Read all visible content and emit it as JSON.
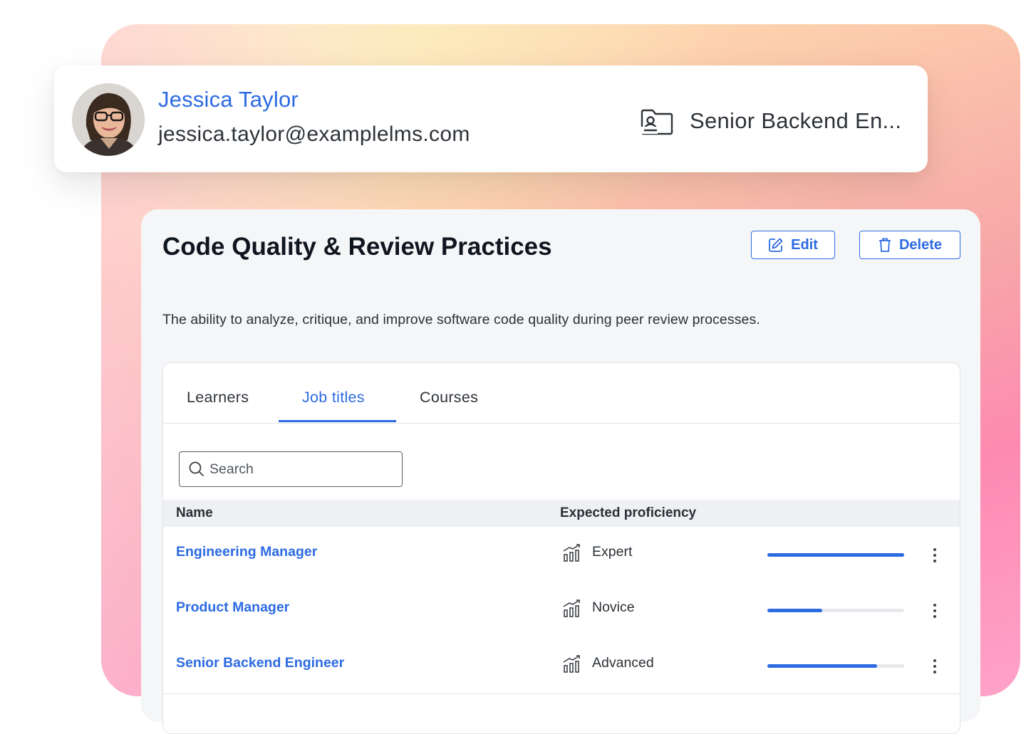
{
  "profile": {
    "name": "Jessica Taylor",
    "email": "jessica.taylor@examplelms.com",
    "job_title": "Senior Backend En..."
  },
  "skill": {
    "title": "Code Quality & Review Practices",
    "description": "The ability to analyze, critique, and improve software code quality during peer review processes.",
    "edit_label": "Edit",
    "delete_label": "Delete"
  },
  "tabs": [
    {
      "label": "Learners",
      "active": false
    },
    {
      "label": "Job titles",
      "active": true
    },
    {
      "label": "Courses",
      "active": false
    }
  ],
  "search": {
    "placeholder": "Search"
  },
  "table": {
    "columns": {
      "name": "Name",
      "proficiency": "Expected proficiency"
    },
    "rows": [
      {
        "name": "Engineering Manager",
        "proficiency": "Expert",
        "level": 1.0
      },
      {
        "name": "Product Manager",
        "proficiency": "Novice",
        "level": 0.4
      },
      {
        "name": "Senior Backend Engineer",
        "proficiency": "Advanced",
        "level": 0.8
      }
    ]
  },
  "colors": {
    "accent": "#2d6be2",
    "title": "#10161f"
  }
}
